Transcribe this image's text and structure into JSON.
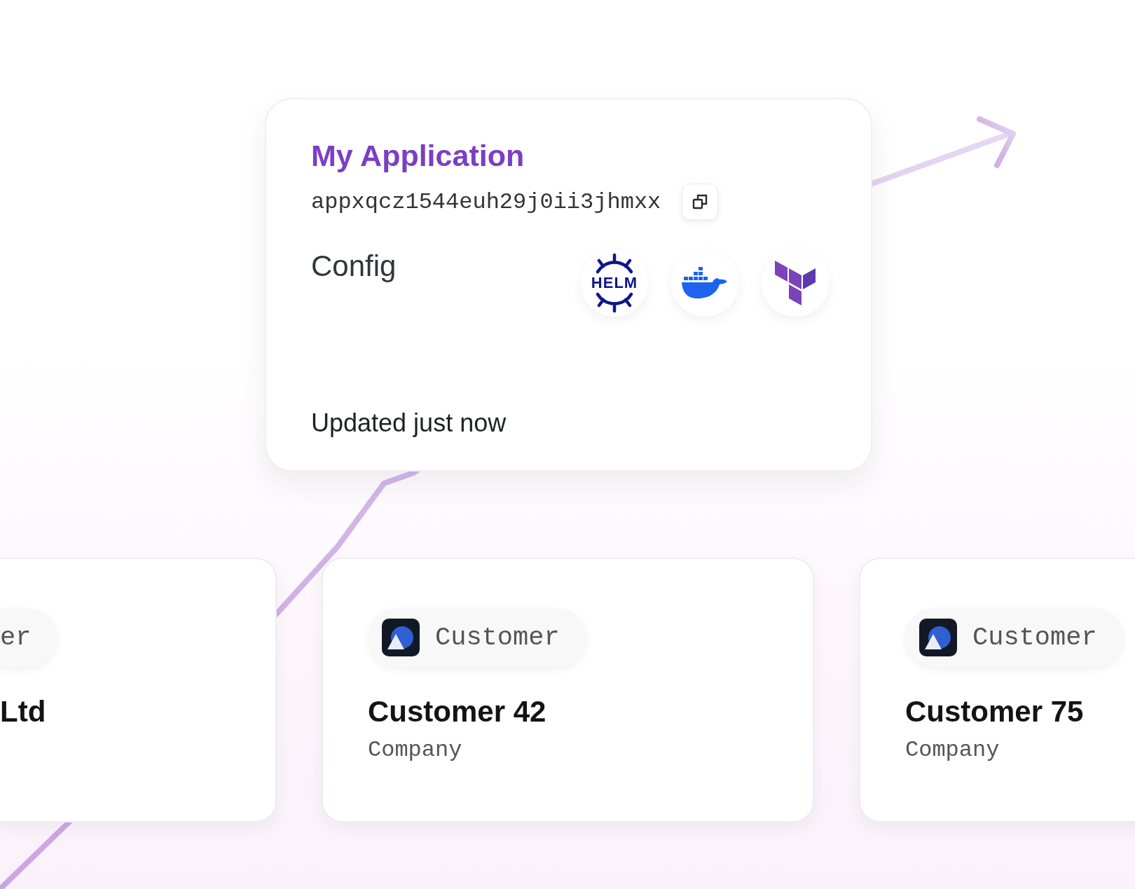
{
  "app_card": {
    "title": "My Application",
    "app_id": "appxqcz1544euh29j0ii3jhmxx",
    "config_label": "Config",
    "tools": [
      {
        "kind": "helm",
        "label": "HELM"
      },
      {
        "kind": "docker"
      },
      {
        "kind": "terraform"
      }
    ],
    "updated": "Updated just now"
  },
  "customers": [
    {
      "kind": "cropped",
      "badge": "er",
      "name": "Ltd"
    },
    {
      "kind": "full",
      "badge": "Customer",
      "name": "Customer 42",
      "type": "Company"
    },
    {
      "kind": "full",
      "badge": "Customer",
      "name": "Customer 75",
      "type": "Company"
    }
  ]
}
